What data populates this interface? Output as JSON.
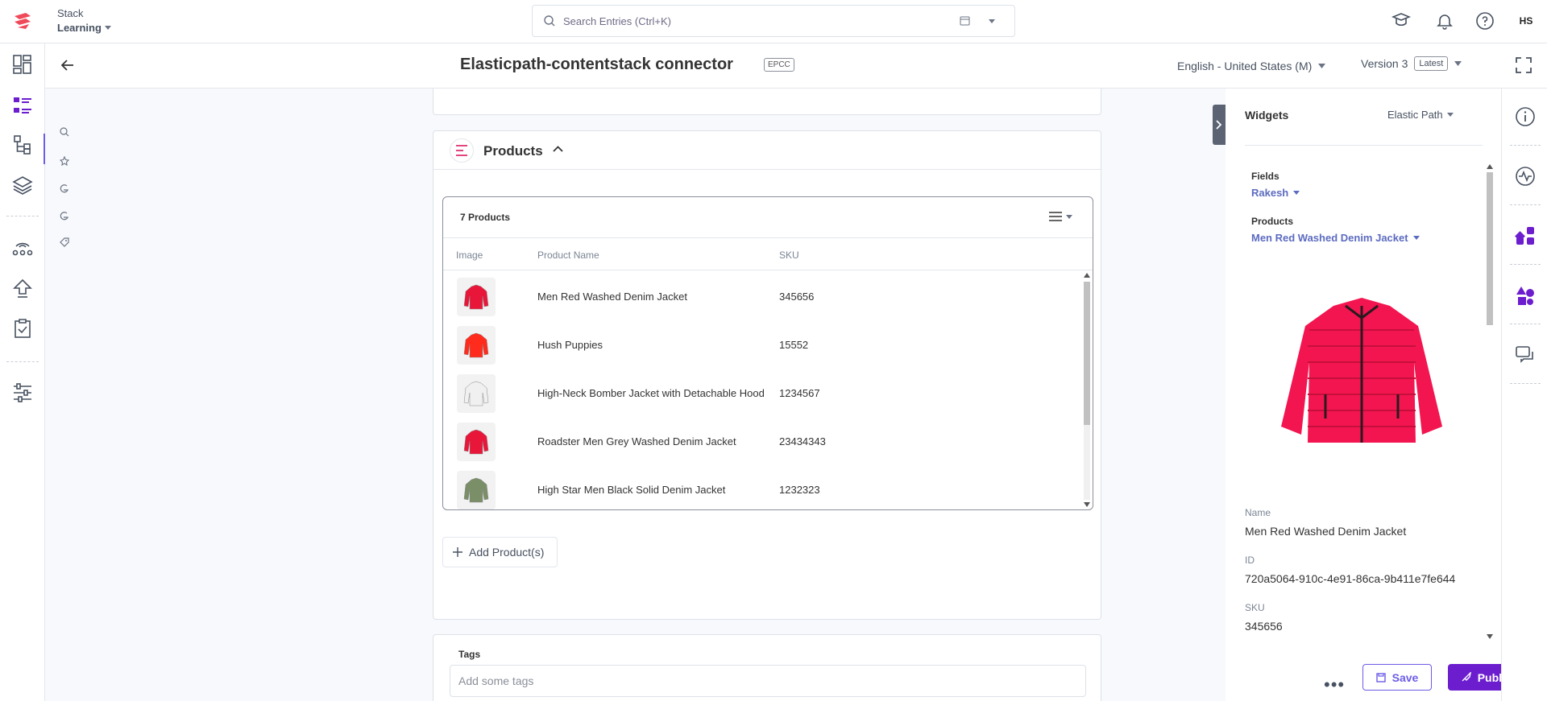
{
  "topbar": {
    "stack_label": "Stack",
    "stack_name": "Learning",
    "search_placeholder": "Search Entries (Ctrl+K)",
    "user_initials": "HS"
  },
  "entry": {
    "title": "Elasticpath-contentstack connector",
    "badge": "EPCC",
    "locale": "English - United States (M)",
    "version": "Version 3",
    "version_tag": "Latest"
  },
  "products_field": {
    "title": "Products",
    "count_label": "7 Products",
    "columns": [
      "Image",
      "Product Name",
      "SKU"
    ],
    "rows": [
      {
        "name": "Men Red Washed Denim Jacket",
        "sku": "345656",
        "thumb_color": "#e8173a"
      },
      {
        "name": "Hush Puppies",
        "sku": "15552",
        "thumb_color": "#ff2b1c"
      },
      {
        "name": "High-Neck Bomber Jacket with Detachable Hood",
        "sku": "1234567",
        "thumb_color": "#f0f0f0"
      },
      {
        "name": "Roadster Men Grey Washed Denim Jacket",
        "sku": "23434343",
        "thumb_color": "#e8173a"
      },
      {
        "name": "High Star Men Black Solid Denim Jacket",
        "sku": "1232323",
        "thumb_color": "#7a8f68"
      }
    ],
    "add_button": "Add Product(s)"
  },
  "tags": {
    "label": "Tags",
    "placeholder": "Add some tags"
  },
  "widgets": {
    "title": "Widgets",
    "selected_widget": "Elastic Path",
    "fields_label": "Fields",
    "fields_value": "Rakesh",
    "products_label": "Products",
    "products_value": "Men Red Washed Denim Jacket",
    "details": [
      {
        "label": "Name",
        "value": "Men Red Washed Denim Jacket"
      },
      {
        "label": "ID",
        "value": "720a5064-910c-4e91-86ca-9b411e7fe644"
      },
      {
        "label": "SKU",
        "value": "345656"
      }
    ]
  },
  "actions": {
    "more": "•••",
    "save": "Save",
    "publish": "Publish"
  },
  "colors": {
    "accent": "#6c1ecf",
    "link": "#5c6bc0",
    "jacket": "#f2154f"
  }
}
